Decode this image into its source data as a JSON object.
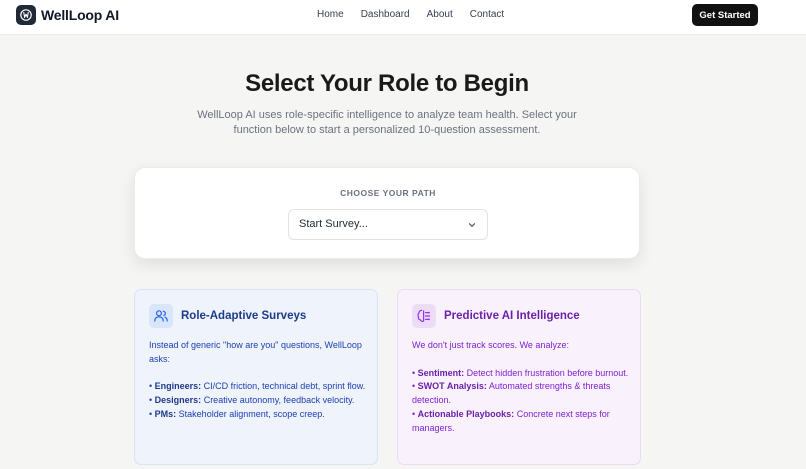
{
  "header": {
    "brand_name": "WellLoop AI",
    "nav": [
      "Home",
      "Dashboard",
      "About",
      "Contact"
    ],
    "cta_label": "Get Started"
  },
  "hero": {
    "title": "Select Your Role to Begin",
    "subtitle": "WellLoop AI uses role-specific intelligence to analyze team health. Select your function below to start a personalized 10-question assessment."
  },
  "role_picker": {
    "label": "CHOOSE YOUR PATH",
    "selected_value": "Start Survey..."
  },
  "features": [
    {
      "title": "Role-Adaptive Surveys",
      "icon": "users-icon",
      "intro": "Instead of generic \"how are you\" questions, WellLoop asks:",
      "items": [
        {
          "term": "Engineers:",
          "text": " CI/CD friction, technical debt, sprint flow."
        },
        {
          "term": "Designers:",
          "text": " Creative autonomy, feedback velocity."
        },
        {
          "term": "PMs:",
          "text": " Stakeholder alignment, scope creep."
        }
      ]
    },
    {
      "title": "Predictive AI Intelligence",
      "icon": "brain-icon",
      "intro": "We don't just track scores. We analyze:",
      "items": [
        {
          "term": "Sentiment:",
          "text": " Detect hidden frustration before burnout."
        },
        {
          "term": "SWOT Analysis:",
          "text": " Automated strengths & threats detection."
        },
        {
          "term": "Actionable Playbooks:",
          "text": " Concrete next steps for managers."
        }
      ]
    }
  ],
  "colors": {
    "cta_bg": "#111111",
    "adaptive_card_bg": "#eef3fc",
    "adaptive_text": "#1e40af",
    "predictive_card_bg": "#f9f1fc",
    "predictive_text": "#7e22ce"
  }
}
